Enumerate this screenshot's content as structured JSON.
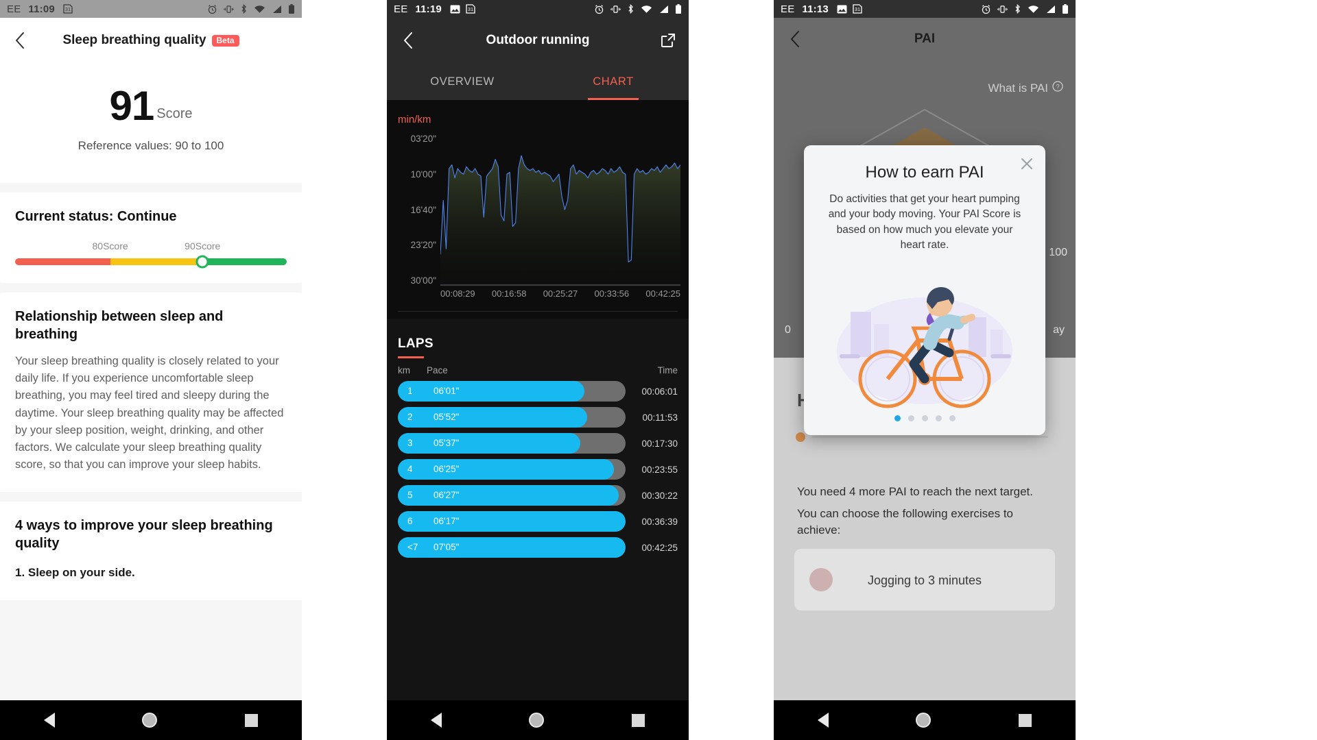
{
  "panel1": {
    "statusbar": {
      "carrier": "EE",
      "time": "11:09",
      "left_icons": [
        "calendar-icon"
      ],
      "right_icons": [
        "alarm-icon",
        "vibrate-icon",
        "bluetooth-icon",
        "wifi-icon",
        "signal-icon",
        "battery-icon"
      ]
    },
    "header": {
      "back": "back-icon",
      "title": "Sleep breathing quality",
      "badge": "Beta"
    },
    "score": {
      "value": "91",
      "unit": "Score",
      "reference": "Reference values: 90 to 100"
    },
    "status_card": {
      "title": "Current status: Continue",
      "marker_labels": [
        "80Score",
        "90Score"
      ],
      "segments": [
        {
          "color": "#f4604f",
          "pct": 35
        },
        {
          "color": "#f7c413",
          "pct": 34
        },
        {
          "color": "#21b55b",
          "pct": 31
        }
      ],
      "knob_pct": 69
    },
    "relationship_card": {
      "title": "Relationship between sleep and breathing",
      "body": "Your sleep breathing quality is closely related to your daily life. If you experience uncomfortable sleep breathing, you may feel tired and sleepy during the daytime. Your sleep breathing quality may be affected by your sleep position, weight, drinking, and other factors. We calculate your sleep breathing quality score, so that you can improve your sleep habits."
    },
    "improve_card": {
      "title": "4 ways to improve your sleep breathing quality",
      "first_item": "1. Sleep on your side."
    }
  },
  "panel2": {
    "statusbar": {
      "carrier": "EE",
      "time": "11:19",
      "left_icons": [
        "image-icon",
        "calendar-icon"
      ],
      "right_icons": [
        "alarm-icon",
        "vibrate-icon",
        "bluetooth-icon",
        "wifi-icon",
        "signal-icon",
        "battery-icon"
      ]
    },
    "header": {
      "back": "back-icon",
      "title": "Outdoor running",
      "share": "share-icon"
    },
    "tabs": [
      {
        "label": "OVERVIEW",
        "active": false
      },
      {
        "label": "CHART",
        "active": true
      }
    ],
    "laps_section": {
      "title": "LAPS",
      "columns": {
        "km": "km",
        "pace": "Pace",
        "time": "Time"
      },
      "rows": [
        {
          "km": "1",
          "pace": "06'01\"",
          "time": "00:06:01",
          "fill": 82
        },
        {
          "km": "2",
          "pace": "05'52\"",
          "time": "00:11:53",
          "fill": 83
        },
        {
          "km": "3",
          "pace": "05'37\"",
          "time": "00:17:30",
          "fill": 80
        },
        {
          "km": "4",
          "pace": "06'25\"",
          "time": "00:23:55",
          "fill": 95
        },
        {
          "km": "5",
          "pace": "06'27\"",
          "time": "00:30:22",
          "fill": 97
        },
        {
          "km": "6",
          "pace": "06'17\"",
          "time": "00:36:39",
          "fill": 100
        },
        {
          "km": "<7",
          "pace": "07'05\"",
          "time": "00:42:25",
          "fill": 100
        }
      ]
    }
  },
  "panel3": {
    "statusbar": {
      "carrier": "EE",
      "time": "11:13",
      "left_icons": [
        "image-icon",
        "calendar-icon"
      ],
      "right_icons": [
        "alarm-icon",
        "vibrate-icon",
        "bluetooth-icon",
        "wifi-icon",
        "signal-icon",
        "battery-icon"
      ]
    },
    "header": {
      "back": "back-icon",
      "title": "PAI"
    },
    "what_is_pai": "What is PAI",
    "axis": {
      "max": "100",
      "min": "0",
      "right": "ay"
    },
    "behind": {
      "heading": "H",
      "need_text": "You need 4 more PAI to reach the next target.",
      "choose_text": "You can choose the following exercises to achieve:",
      "exercise": "Jogging to 3 minutes"
    },
    "modal": {
      "close": "close-icon",
      "title": "How to earn PAI",
      "body": "Do activities that get your heart pumping and your body moving. Your PAI Score is based on how much you elevate your heart rate.",
      "illustration": "cyclist-illustration",
      "dots": 5,
      "active_dot": 0
    }
  },
  "navbar": {
    "back": "nav-back-icon",
    "home": "nav-home-icon",
    "recents": "nav-recents-icon"
  },
  "chart_data": {
    "type": "line",
    "title": "",
    "ylabel": "min/km",
    "xlabel": "",
    "ytick_labels": [
      "03'20\"",
      "10'00\"",
      "16'40\"",
      "23'20\"",
      "30'00\""
    ],
    "ytick_values": [
      200,
      600,
      1000,
      1400,
      1800
    ],
    "ylim": [
      1800,
      200
    ],
    "xtick_labels": [
      "00:08:29",
      "00:16:58",
      "00:25:27",
      "00:33:56",
      "00:42:25"
    ],
    "series": [
      {
        "name": "pace",
        "color": "#4f86f7",
        "values": [
          1480,
          900,
          1420,
          560,
          520,
          660,
          560,
          600,
          620,
          540,
          580,
          600,
          560,
          620,
          640,
          1080,
          640,
          600,
          560,
          460,
          540,
          1060,
          1120,
          620,
          600,
          1180,
          1140,
          560,
          420,
          520,
          560,
          580,
          560,
          600,
          580,
          620,
          600,
          620,
          640,
          700,
          660,
          620,
          860,
          1000,
          900,
          560,
          520,
          620,
          580,
          600,
          620,
          660,
          600,
          580,
          620,
          600,
          560,
          580,
          620,
          560,
          600,
          580,
          540,
          600,
          620,
          1560,
          1540,
          620,
          560,
          600,
          580,
          620,
          600,
          560,
          580,
          540,
          600,
          560,
          520,
          560,
          540,
          500,
          560,
          520
        ]
      }
    ],
    "grid": false,
    "legend": "none"
  }
}
